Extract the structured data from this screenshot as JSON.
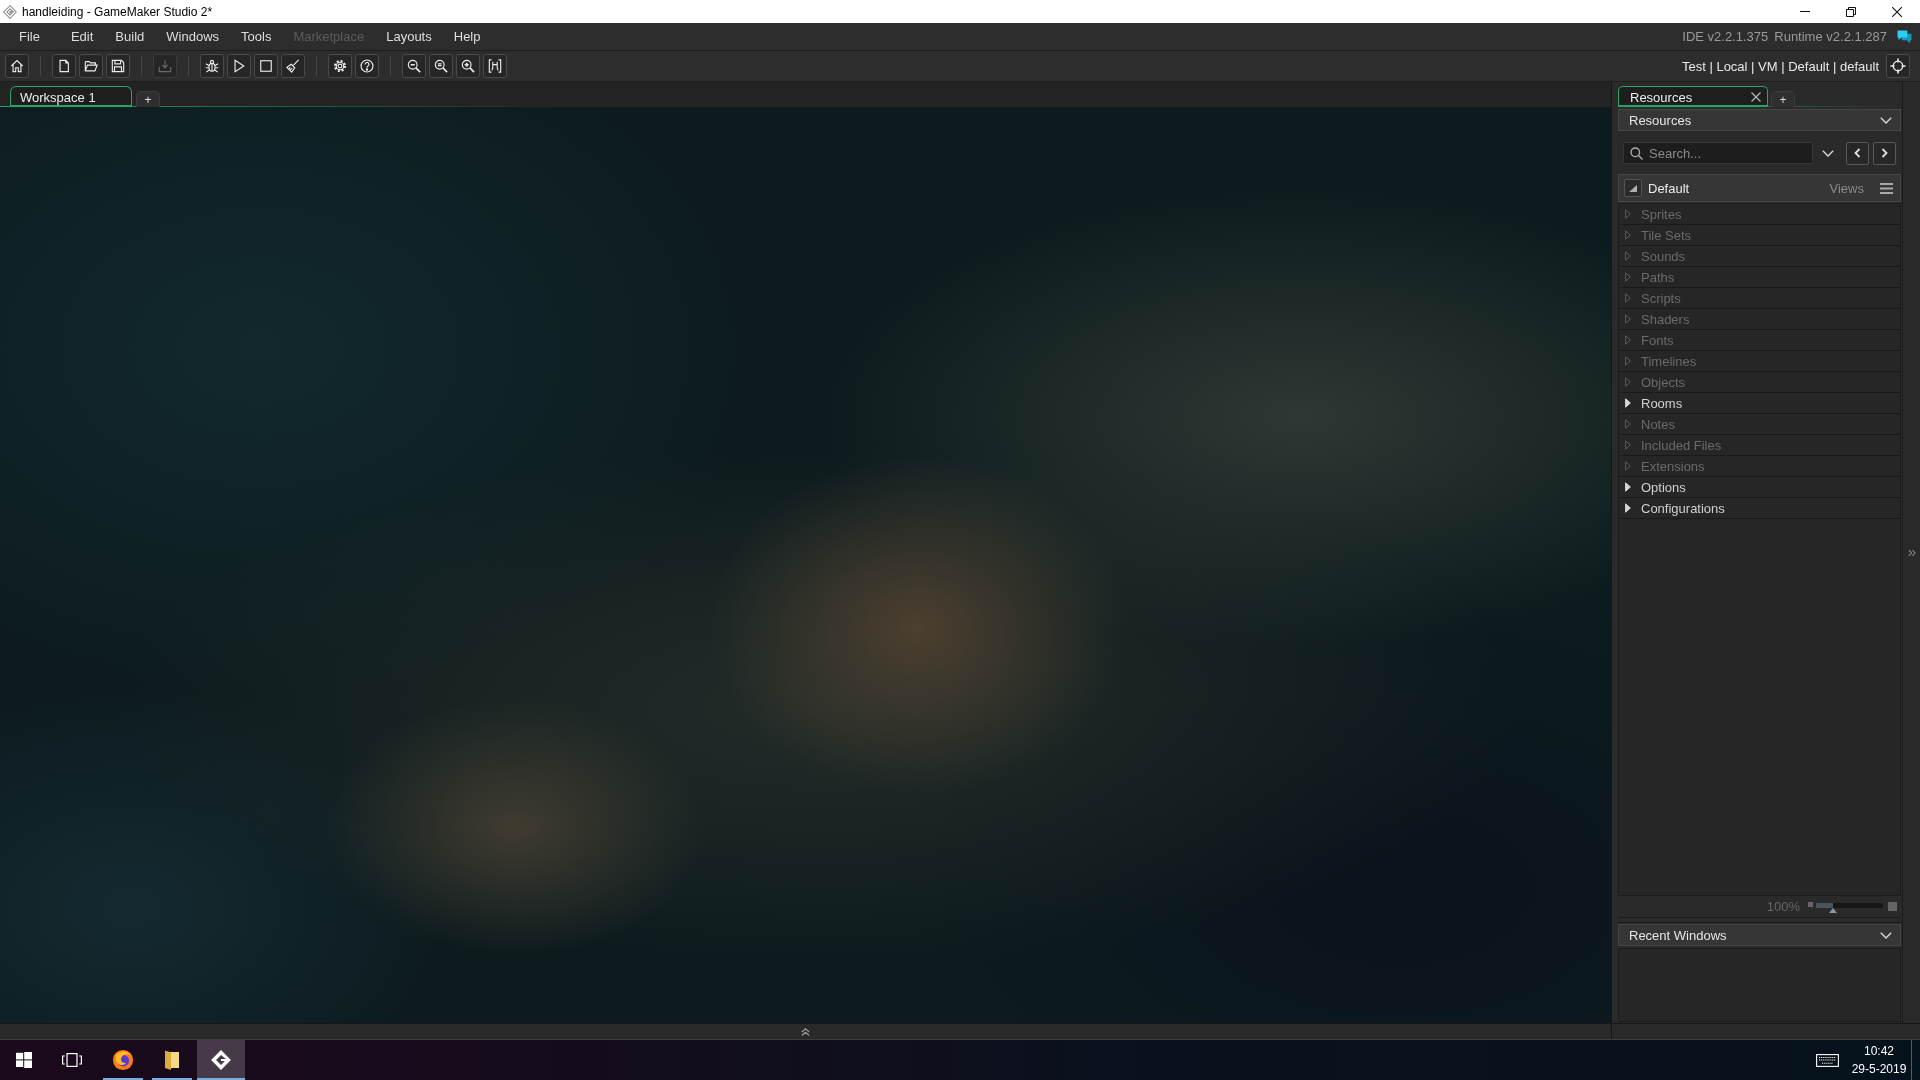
{
  "title_bar": {
    "title": "handleiding - GameMaker Studio 2*"
  },
  "menu_bar": {
    "items": [
      {
        "label": "File",
        "disabled": false
      },
      {
        "label": "Edit",
        "disabled": false
      },
      {
        "label": "Build",
        "disabled": false
      },
      {
        "label": "Windows",
        "disabled": false
      },
      {
        "label": "Tools",
        "disabled": false
      },
      {
        "label": "Marketplace",
        "disabled": true
      },
      {
        "label": "Layouts",
        "disabled": false
      },
      {
        "label": "Help",
        "disabled": false
      }
    ],
    "versions": [
      "IDE v2.2.1.375",
      "Runtime v2.2.1.287"
    ]
  },
  "toolbar": {
    "groups": [
      [
        {
          "kind": "home",
          "disabled": false
        }
      ],
      [
        {
          "kind": "new",
          "disabled": false
        },
        {
          "kind": "open",
          "disabled": false
        },
        {
          "kind": "save",
          "disabled": false
        }
      ],
      [
        {
          "kind": "export",
          "disabled": true
        }
      ],
      [
        {
          "kind": "debug",
          "disabled": false
        },
        {
          "kind": "run",
          "disabled": false
        },
        {
          "kind": "stop",
          "disabled": false
        },
        {
          "kind": "clean",
          "disabled": false
        }
      ],
      [
        {
          "kind": "settings",
          "disabled": false
        },
        {
          "kind": "help",
          "disabled": false
        }
      ],
      [
        {
          "kind": "zoom_out",
          "disabled": false
        },
        {
          "kind": "zoom_reset",
          "disabled": false
        },
        {
          "kind": "zoom_in",
          "disabled": false
        },
        {
          "kind": "fit",
          "disabled": false
        }
      ]
    ],
    "target": "Test | Local | VM | Default | default"
  },
  "workspace_tabs": {
    "tabs": [
      {
        "label": "Workspace 1",
        "selected": true
      }
    ],
    "add": "+"
  },
  "resources_panel": {
    "tabs": [
      {
        "label": "Resources",
        "selected": true
      }
    ],
    "add": "+",
    "header": "Resources",
    "search": {
      "placeholder": "Search..."
    },
    "view": {
      "name": "Default",
      "views": "Views"
    },
    "tree": [
      {
        "label": "Sprites",
        "empty": true,
        "expanded": false
      },
      {
        "label": "Tile Sets",
        "empty": true,
        "expanded": false
      },
      {
        "label": "Sounds",
        "empty": true,
        "expanded": false
      },
      {
        "label": "Paths",
        "empty": true,
        "expanded": false
      },
      {
        "label": "Scripts",
        "empty": true,
        "expanded": false
      },
      {
        "label": "Shaders",
        "empty": true,
        "expanded": false
      },
      {
        "label": "Fonts",
        "empty": true,
        "expanded": false
      },
      {
        "label": "Timelines",
        "empty": true,
        "expanded": false
      },
      {
        "label": "Objects",
        "empty": true,
        "expanded": false
      },
      {
        "label": "Rooms",
        "empty": false,
        "expanded": false
      },
      {
        "label": "Notes",
        "empty": true,
        "expanded": false
      },
      {
        "label": "Included Files",
        "empty": true,
        "expanded": false
      },
      {
        "label": "Extensions",
        "empty": true,
        "expanded": false
      },
      {
        "label": "Options",
        "empty": false,
        "expanded": false
      },
      {
        "label": "Configurations",
        "empty": false,
        "expanded": false
      }
    ],
    "zoom": {
      "reading": "100%",
      "level": 0.25
    },
    "recent_windows": {
      "header": "Recent Windows"
    }
  },
  "taskbar": {
    "apps": [
      {
        "kind": "browser",
        "running": true,
        "selected": false
      },
      {
        "kind": "folder",
        "running": true,
        "selected": false
      },
      {
        "kind": "app",
        "running": true,
        "selected": true
      }
    ],
    "clock": {
      "time": "10:42",
      "date": "29-5-2019"
    }
  }
}
